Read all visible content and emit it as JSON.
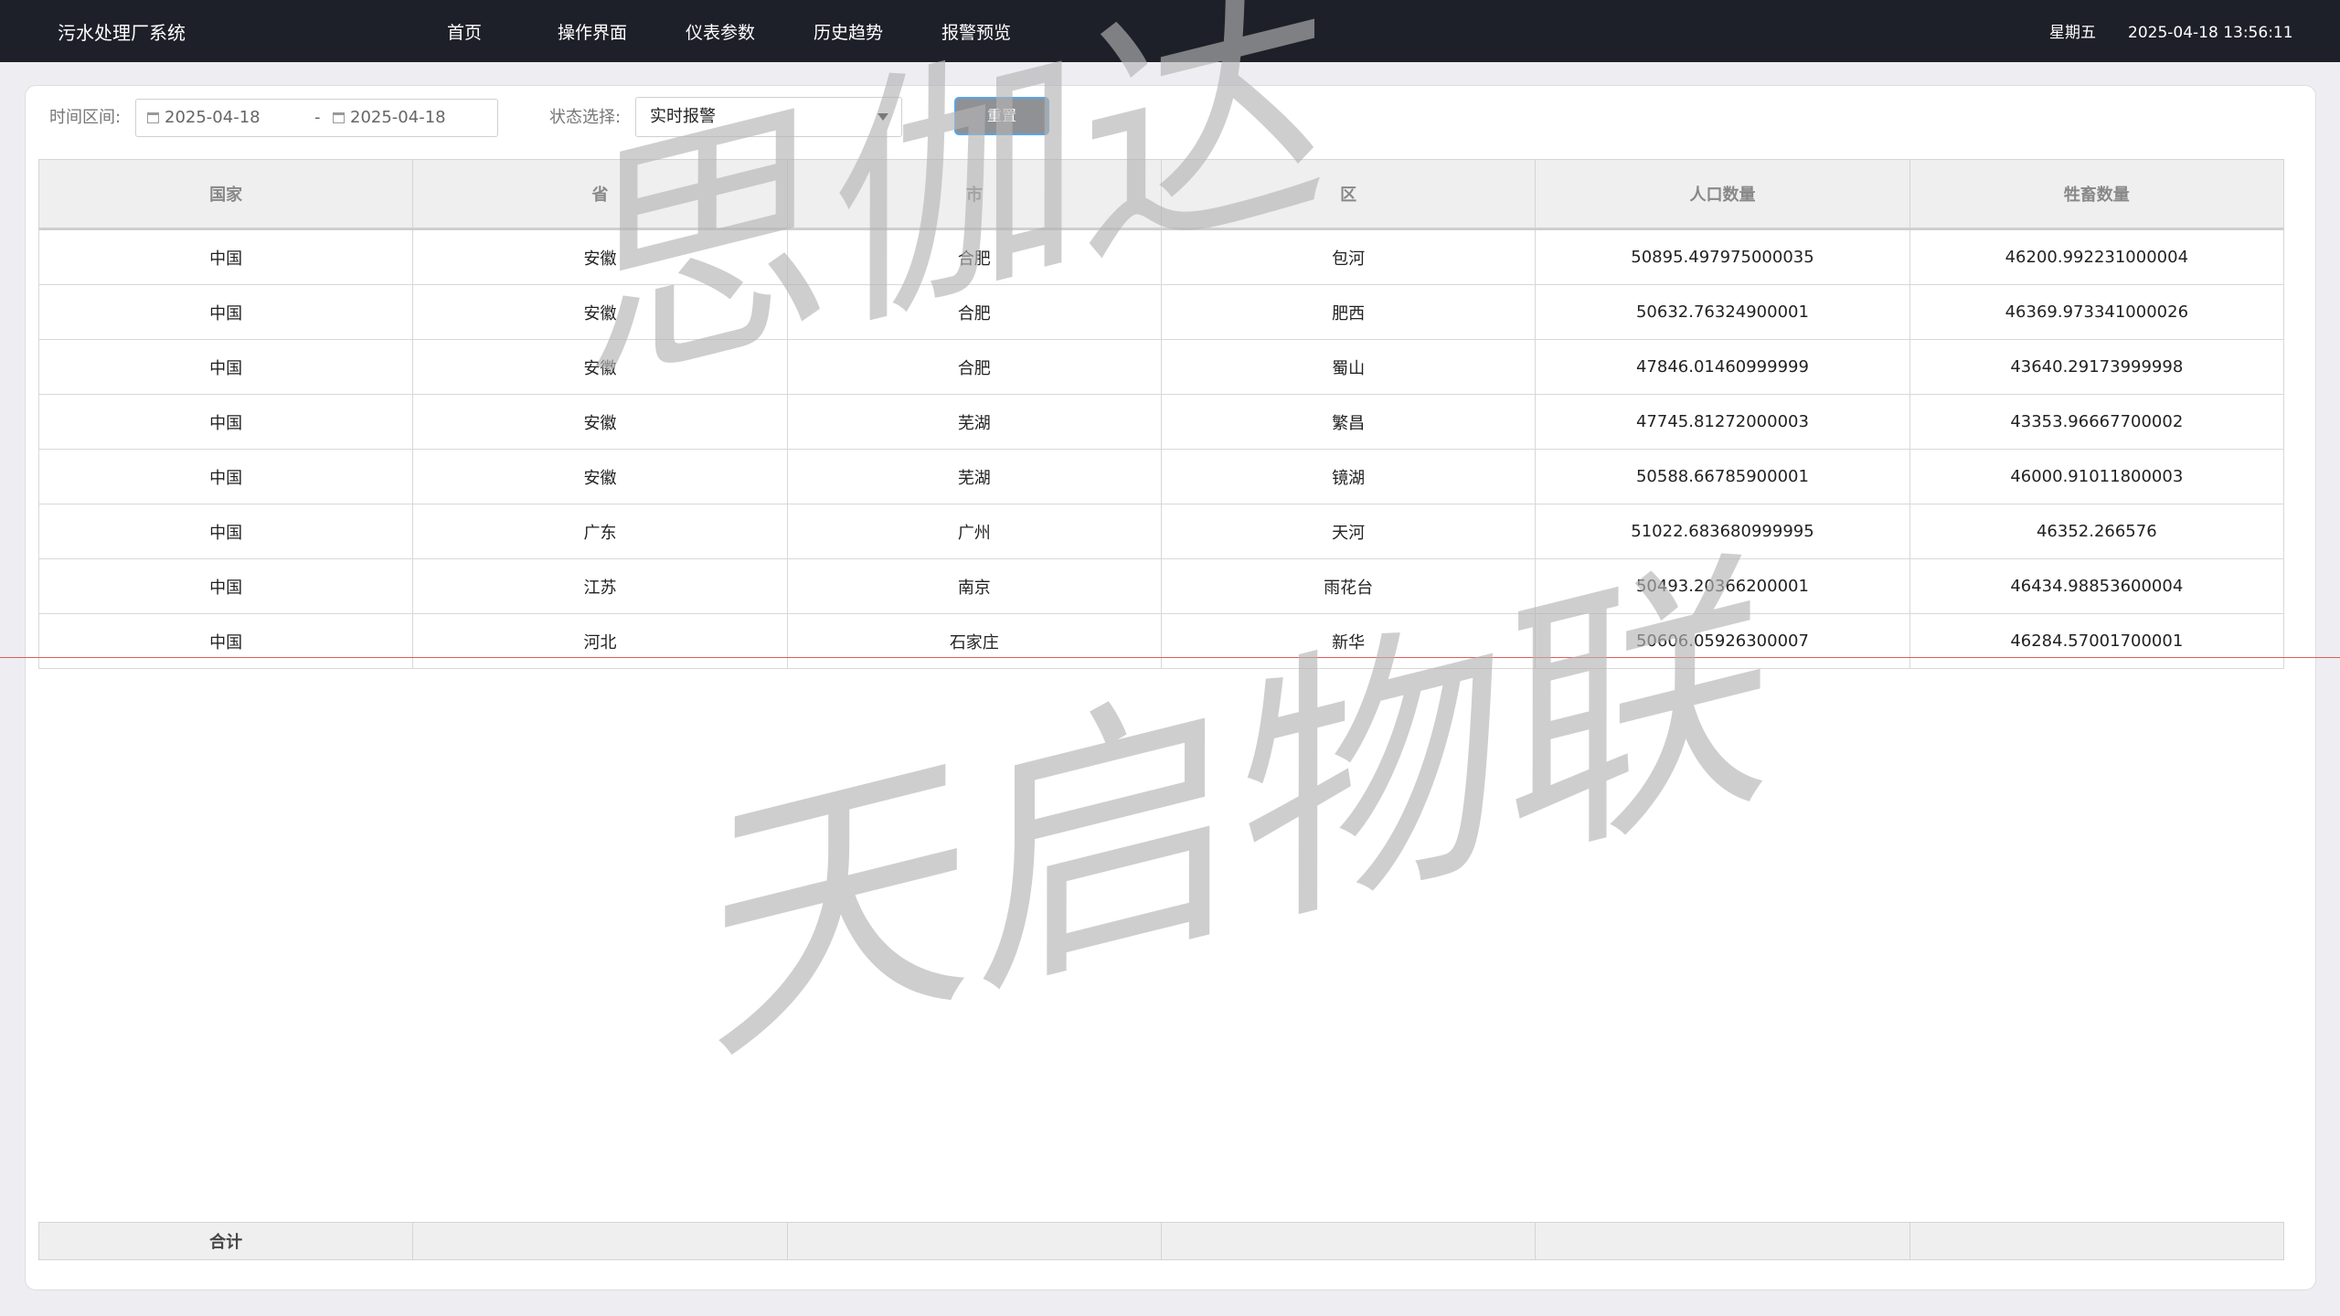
{
  "app": {
    "title": "污水处理厂系统"
  },
  "nav": {
    "items": [
      "首页",
      "操作界面",
      "仪表参数",
      "历史趋势",
      "报警预览"
    ]
  },
  "header": {
    "weekday": "星期五",
    "datetime": "2025-04-18  13:56:11"
  },
  "filters": {
    "time_label": "时间区间:",
    "date_start": "2025-04-18",
    "date_sep": "-",
    "date_end": "2025-04-18",
    "status_label": "状态选择:",
    "status_value": "实时报警",
    "reset_label": "重置"
  },
  "table": {
    "columns": [
      "国家",
      "省",
      "市",
      "区",
      "人口数量",
      "牲畜数量"
    ],
    "rows": [
      [
        "中国",
        "安徽",
        "合肥",
        "包河",
        "50895.497975000035",
        "46200.992231000004"
      ],
      [
        "中国",
        "安徽",
        "合肥",
        "肥西",
        "50632.76324900001",
        "46369.973341000026"
      ],
      [
        "中国",
        "安徽",
        "合肥",
        "蜀山",
        "47846.01460999999",
        "43640.29173999998"
      ],
      [
        "中国",
        "安徽",
        "芜湖",
        "繁昌",
        "47745.81272000003",
        "43353.96667700002"
      ],
      [
        "中国",
        "安徽",
        "芜湖",
        "镜湖",
        "50588.66785900001",
        "46000.91011800003"
      ],
      [
        "中国",
        "广东",
        "广州",
        "天河",
        "51022.683680999995",
        "46352.266576"
      ],
      [
        "中国",
        "江苏",
        "南京",
        "雨花台",
        "50493.20366200001",
        "46434.98853600004"
      ],
      [
        "中国",
        "河北",
        "石家庄",
        "新华",
        "50606.05926300007",
        "46284.57001700001"
      ]
    ],
    "summary_label": "合计"
  },
  "watermark": {
    "line1": "思伽达",
    "line2": "天启物联"
  },
  "colors": {
    "topbar": "#1e2029",
    "background": "#eeeef2",
    "reset_button": "#8f9194",
    "reset_border": "#5aa5e6",
    "marker_line": "#e55a5a"
  }
}
